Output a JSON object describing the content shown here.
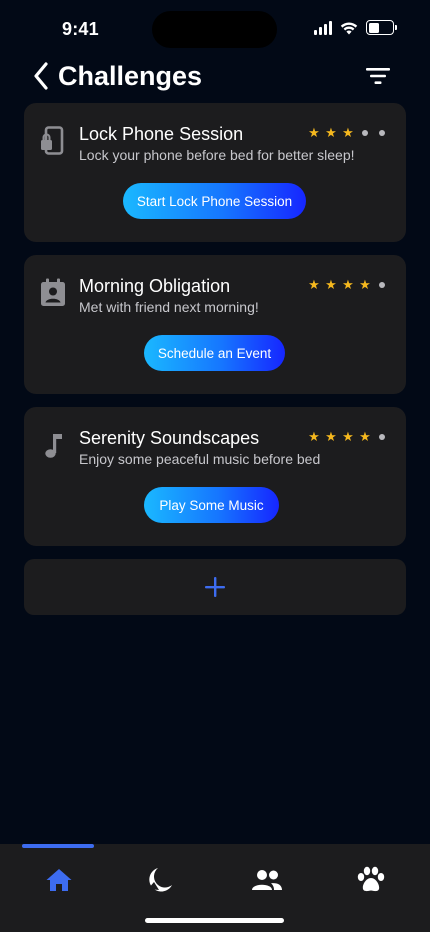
{
  "status_bar": {
    "time": "9:41",
    "icons": [
      "signal-icon",
      "wifi-icon",
      "battery-icon"
    ]
  },
  "header": {
    "title": "Challenges",
    "back_icon": "chevron-left-icon",
    "filter_icon": "filter-icon"
  },
  "challenges": [
    {
      "title": "Lock Phone Session",
      "description": "Lock your phone before bed for better sleep!",
      "button_label": "Start Lock Phone Session",
      "icon": "phone-lock-icon",
      "rating": 3,
      "rating_max": 5
    },
    {
      "title": "Morning Obligation",
      "description": "Met with friend next morning!",
      "button_label": "Schedule an Event",
      "icon": "contact-calendar-icon",
      "rating": 4,
      "rating_max": 5
    },
    {
      "title": "Serenity Soundscapes",
      "description": "Enjoy some peaceful music before bed",
      "button_label": "Play Some Music",
      "icon": "music-note-icon",
      "rating": 4,
      "rating_max": 5
    }
  ],
  "add_button": {
    "icon": "plus-icon"
  },
  "tab_bar": {
    "tabs": [
      {
        "icon": "home-icon",
        "active": true
      },
      {
        "icon": "moon-icon",
        "active": false
      },
      {
        "icon": "people-icon",
        "active": false
      },
      {
        "icon": "paw-icon",
        "active": false
      }
    ]
  },
  "colors": {
    "background": "#020916",
    "card": "#1c1c1e",
    "star": "#f5b81e",
    "accent": "#3d6cf0",
    "button_gradient_start": "#1ab8ff",
    "button_gradient_end": "#1626ff"
  }
}
